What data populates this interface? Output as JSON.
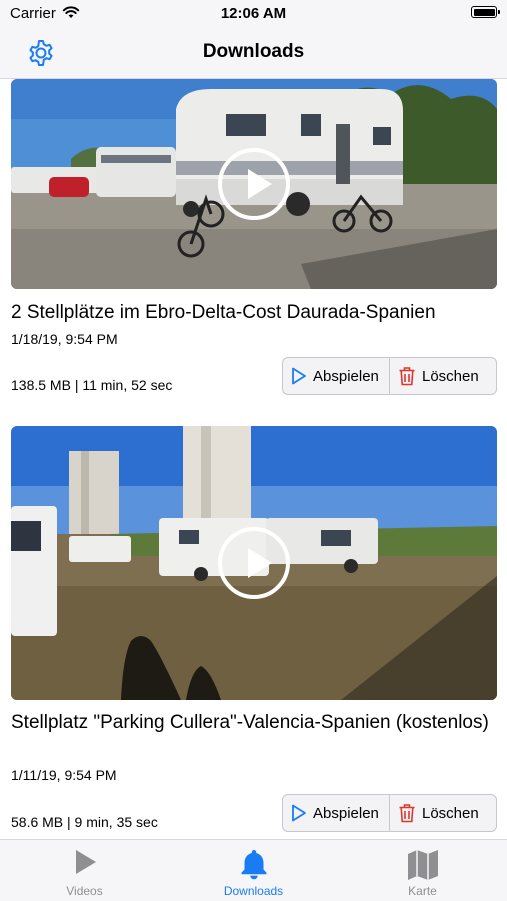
{
  "status_bar": {
    "carrier": "Carrier",
    "time": "12:06 AM"
  },
  "nav": {
    "title": "Downloads"
  },
  "videos": [
    {
      "title": "2 Stellplätze im Ebro-Delta-Cost Daurada-Spanien",
      "date": "1/18/19, 9:54 PM",
      "meta": "138.5 MB | 11 min, 52 sec",
      "play_label": "Abspielen",
      "delete_label": "Löschen"
    },
    {
      "title": "Stellplatz \"Parking Cullera\"-Valencia-Spanien (kostenlos)",
      "date": "1/11/19, 9:54 PM",
      "meta": "58.6 MB | 9 min, 35 sec",
      "play_label": "Abspielen",
      "delete_label": "Löschen"
    }
  ],
  "tabs": [
    {
      "label": "Videos",
      "icon": "play-icon",
      "active": false
    },
    {
      "label": "Downloads",
      "icon": "bell-icon",
      "active": true
    },
    {
      "label": "Karte",
      "icon": "map-icon",
      "active": false
    }
  ],
  "colors": {
    "accent": "#1a7cf5",
    "inactive": "#8e8e93",
    "delete": "#e0352b",
    "bar_bg": "#f6f6f8"
  }
}
